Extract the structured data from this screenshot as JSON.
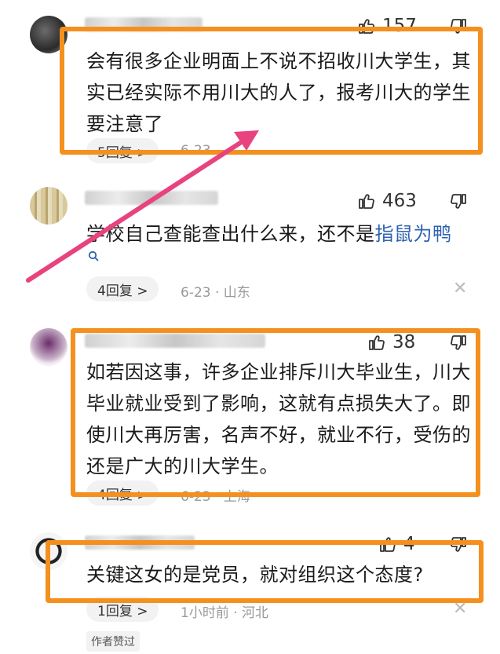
{
  "colors": {
    "highlight": "#f4901e",
    "arrow": "#e8427f",
    "link": "#2f62b0"
  },
  "comments": [
    {
      "likes": "157",
      "text": "会有很多企业明面上不说不招收川大学生，其实已经实际不用川大的人了，报考川大的学生要注意了",
      "reply_label": "5回复 >",
      "meta": "6-23"
    },
    {
      "likes": "463",
      "text": "学校自己查能查出什么来，还不是",
      "link_text": "指鼠为鸭",
      "reply_label": "4回复 >",
      "meta": "6-23 · 山东"
    },
    {
      "likes": "38",
      "text": "如若因这事，许多企业排斥川大毕业生，川大毕业就业受到了影响，这就有点损失大了。即使川大再厉害，名声不好，就业不行，受伤的还是广大的川大学生。",
      "reply_label": "4回复 >",
      "meta": "6-23 · 上海"
    },
    {
      "likes": "4",
      "text": "关键这女的是党员，就对组织这个态度?",
      "reply_label": "1回复 >",
      "meta": "1小时前 · 河北",
      "badge": "作者赞过"
    }
  ]
}
